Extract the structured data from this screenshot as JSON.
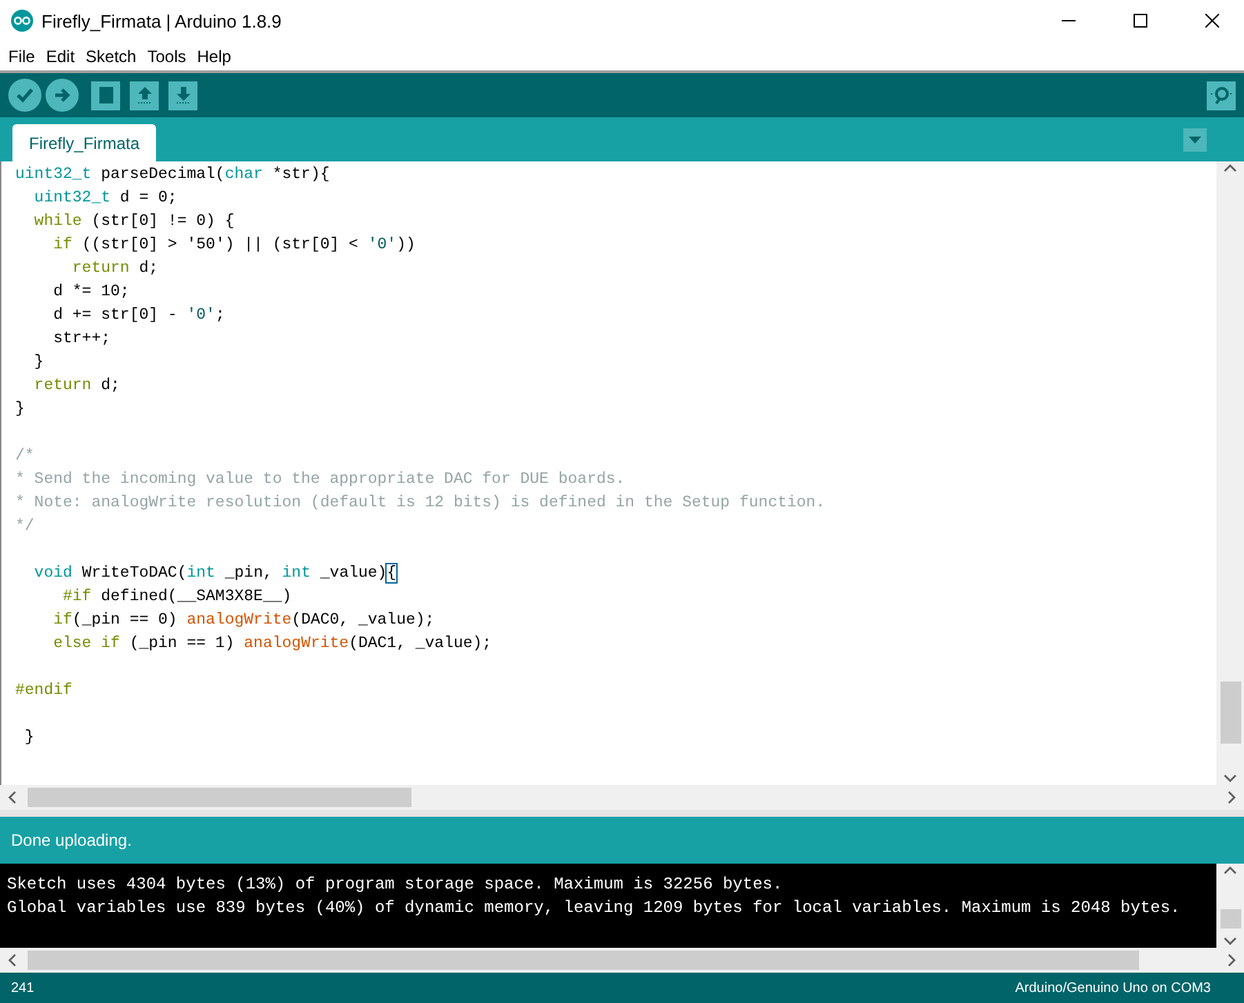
{
  "window": {
    "title": "Firefly_Firmata | Arduino 1.8.9"
  },
  "menu": [
    "File",
    "Edit",
    "Sketch",
    "Tools",
    "Help"
  ],
  "tabs": [
    {
      "label": "Firefly_Firmata",
      "selected": true
    }
  ],
  "code": [
    {
      "kind": "code",
      "tokens": [
        {
          "t": "uint32_t",
          "kind": "type"
        },
        {
          "t": " parseDecimal(",
          "kind": "plain"
        },
        {
          "t": "char",
          "kind": "type"
        },
        {
          "t": " *str){",
          "kind": "plain"
        }
      ]
    },
    {
      "kind": "code",
      "tokens": [
        {
          "t": "  uint32_t",
          "kind": "type"
        },
        {
          "t": " d = 0;",
          "kind": "plain"
        }
      ]
    },
    {
      "kind": "code",
      "tokens": [
        {
          "t": "  while",
          "kind": "keyword"
        },
        {
          "t": " (str[0] != 0) {",
          "kind": "plain"
        }
      ]
    },
    {
      "kind": "code",
      "tokens": [
        {
          "t": "    if",
          "kind": "keyword"
        },
        {
          "t": " ((str[0] > '50') || (str[0] < ",
          "kind": "plain"
        },
        {
          "t": "'0'",
          "kind": "string"
        },
        {
          "t": "))",
          "kind": "plain"
        }
      ]
    },
    {
      "kind": "code",
      "tokens": [
        {
          "t": "      return",
          "kind": "keyword"
        },
        {
          "t": " d;",
          "kind": "plain"
        }
      ]
    },
    {
      "kind": "code",
      "tokens": [
        {
          "t": "    d *= 10;",
          "kind": "plain"
        }
      ]
    },
    {
      "kind": "code",
      "tokens": [
        {
          "t": "    d += str[0] - ",
          "kind": "plain"
        },
        {
          "t": "'0'",
          "kind": "string"
        },
        {
          "t": ";",
          "kind": "plain"
        }
      ]
    },
    {
      "kind": "code",
      "tokens": [
        {
          "t": "    str++;",
          "kind": "plain"
        }
      ]
    },
    {
      "kind": "code",
      "tokens": [
        {
          "t": "  }",
          "kind": "plain"
        }
      ]
    },
    {
      "kind": "code",
      "tokens": [
        {
          "t": "  return",
          "kind": "keyword"
        },
        {
          "t": " d;",
          "kind": "plain"
        }
      ]
    },
    {
      "kind": "code",
      "tokens": [
        {
          "t": "}",
          "kind": "plain"
        }
      ]
    },
    {
      "kind": "blank"
    },
    {
      "kind": "code",
      "tokens": [
        {
          "t": "/*",
          "kind": "comment"
        }
      ]
    },
    {
      "kind": "code",
      "tokens": [
        {
          "t": "* Send the incoming value to the appropriate DAC for DUE boards.",
          "kind": "comment"
        }
      ]
    },
    {
      "kind": "code",
      "tokens": [
        {
          "t": "* Note: analogWrite resolution (default is 12 bits) is defined in the Setup function.",
          "kind": "comment"
        }
      ]
    },
    {
      "kind": "code",
      "tokens": [
        {
          "t": "*/",
          "kind": "comment"
        }
      ]
    },
    {
      "kind": "blank"
    },
    {
      "kind": "code",
      "tokens": [
        {
          "t": "  void",
          "kind": "type"
        },
        {
          "t": " WriteToDAC(",
          "kind": "plain"
        },
        {
          "t": "int",
          "kind": "type"
        },
        {
          "t": " _pin, ",
          "kind": "plain"
        },
        {
          "t": "int",
          "kind": "type"
        },
        {
          "t": " _value)",
          "kind": "plain"
        },
        {
          "t": "{",
          "kind": "bracket"
        }
      ]
    },
    {
      "kind": "code",
      "tokens": [
        {
          "t": "     #if",
          "kind": "keyword"
        },
        {
          "t": " defined(__SAM3X8E__)",
          "kind": "plain"
        }
      ]
    },
    {
      "kind": "code",
      "tokens": [
        {
          "t": "    if",
          "kind": "keyword"
        },
        {
          "t": "(_pin == 0) ",
          "kind": "plain"
        },
        {
          "t": "analogWrite",
          "kind": "function"
        },
        {
          "t": "(DAC0, _value);",
          "kind": "plain"
        }
      ]
    },
    {
      "kind": "code",
      "tokens": [
        {
          "t": "    else if",
          "kind": "keyword"
        },
        {
          "t": " (_pin == 1) ",
          "kind": "plain"
        },
        {
          "t": "analogWrite",
          "kind": "function"
        },
        {
          "t": "(DAC1, _value);",
          "kind": "plain"
        }
      ]
    },
    {
      "kind": "blank"
    },
    {
      "kind": "code",
      "tokens": [
        {
          "t": "#endif",
          "kind": "keyword"
        }
      ]
    },
    {
      "kind": "blank"
    },
    {
      "kind": "code",
      "tokens": [
        {
          "t": " }",
          "kind": "plain"
        }
      ]
    }
  ],
  "status": {
    "message": "Done uploading."
  },
  "console": [
    "Sketch uses 4304 bytes (13%) of program storage space. Maximum is 32256 bytes.",
    "Global variables use 839 bytes (40%) of dynamic memory, leaving 1209 bytes for local variables. Maximum is 2048 bytes."
  ],
  "footer": {
    "line": "241",
    "board": "Arduino/Genuino Uno on COM3"
  }
}
